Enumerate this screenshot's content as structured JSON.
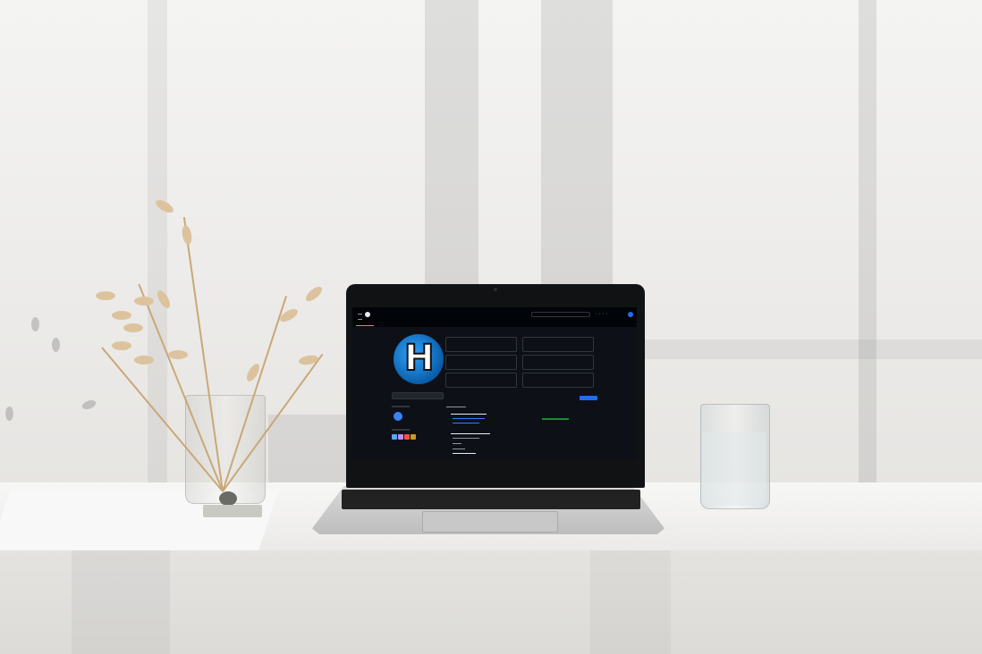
{
  "scene": {
    "description_colors": {
      "wall": "#eeeeec",
      "desk": "#f3f3f1",
      "laptop_lid": "#111214",
      "screen_bg": "#0d1117",
      "accent": "#2f81f7"
    }
  },
  "gh": {
    "username": "",
    "search_placeholder": "",
    "tabs": [
      "",
      "",
      "",
      "",
      ""
    ],
    "pinned_title": "",
    "customize_label": "",
    "contrib_title": "",
    "repos": [
      {
        "name": "",
        "lang": ""
      },
      {
        "name": "",
        "lang": ""
      },
      {
        "name": "",
        "lang": ""
      },
      {
        "name": "",
        "lang": ""
      },
      {
        "name": "",
        "lang": ""
      },
      {
        "name": "",
        "lang": ""
      }
    ]
  }
}
